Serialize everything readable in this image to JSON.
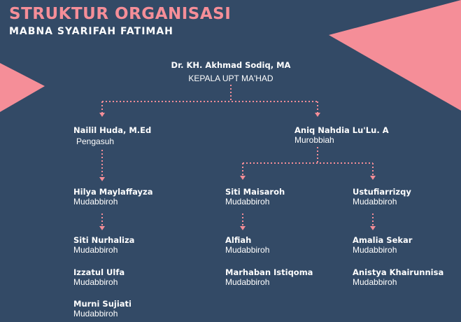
{
  "header": {
    "title": "STRUKTUR ORGANISASI",
    "subtitle": "MABNA SYARIFAH FATIMAH"
  },
  "colors": {
    "background": "#334a66",
    "accent": "#f58e98",
    "text": "#ffffff"
  },
  "org": {
    "head": {
      "name": "Dr. KH. Akhmad Sodiq, MA",
      "role": "KEPALA UPT MA'HAD"
    },
    "pengasuh": {
      "name": "Nailil Huda, M.Ed",
      "role": "Pengasuh"
    },
    "murobbiah": {
      "name": "Aniq Nahdia Lu'Lu. A",
      "role": "Murobbiah"
    },
    "col1": [
      {
        "name": "Hilya Maylaffayza",
        "role": "Mudabbiroh"
      },
      {
        "name": "Siti Nurhaliza",
        "role": "Mudabbiroh"
      },
      {
        "name": "Izzatul Ulfa",
        "role": "Mudabbiroh"
      },
      {
        "name": "Murni Sujiati",
        "role": "Mudabbiroh"
      }
    ],
    "col2": [
      {
        "name": "Siti Maisaroh",
        "role": "Mudabbiroh"
      },
      {
        "name": "Alfiah",
        "role": "Mudabbiroh"
      },
      {
        "name": "Marhaban Istiqoma",
        "role": "Mudabbiroh"
      }
    ],
    "col3": [
      {
        "name": "Ustufiarrizqy",
        "role": "Mudabbiroh"
      },
      {
        "name": "Amalia Sekar",
        "role": "Mudabbiroh"
      },
      {
        "name": "Anistya Khairunnisa",
        "role": "Mudabbiroh"
      }
    ]
  }
}
